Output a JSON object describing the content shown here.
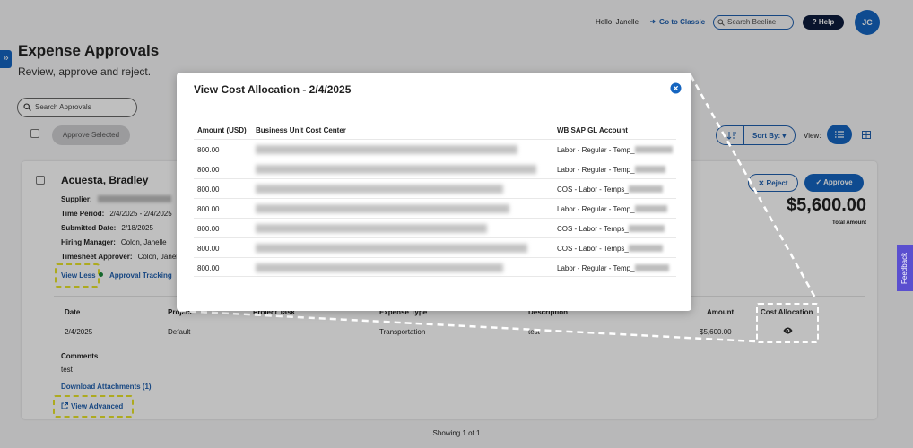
{
  "header": {
    "greeting": "Hello, Janelle",
    "go_classic": "Go to Classic",
    "search_placeholder": "Search Beeline",
    "help_label": "? Help",
    "avatar_initials": "JC"
  },
  "page": {
    "title": "Expense Approvals",
    "subtitle": "Review, approve and reject."
  },
  "toolbar": {
    "search_placeholder": "Search Approvals",
    "approve_selected": "Approve Selected",
    "sort_by": "Sort By:",
    "view_label": "View:"
  },
  "card": {
    "name": "Acuesta, Bradley",
    "supplier_label": "Supplier:",
    "time_period_label": "Time Period:",
    "time_period_value": "2/4/2025 - 2/4/2025",
    "submitted_label": "Submitted Date:",
    "submitted_value": "2/18/2025",
    "hiring_manager_label": "Hiring Manager:",
    "hiring_manager_value": "Colon, Janelle",
    "timesheet_approver_label": "Timesheet Approver:",
    "timesheet_approver_value": "Colon, Janel",
    "view_less": "View Less",
    "approval_tracking": "Approval Tracking",
    "reject": "Reject",
    "approve": "Approve",
    "total": "$5,600.00",
    "total_label": "Total Amount",
    "table_headers": {
      "date": "Date",
      "project": "Project",
      "project_task": "Project Task",
      "expense_type": "Expense Type",
      "description": "Description",
      "amount": "Amount",
      "cost_allocation": "Cost Allocation"
    },
    "row": {
      "date": "2/4/2025",
      "project": "Default",
      "expense_type": "Transportation",
      "description": "test",
      "amount": "$5,600.00"
    },
    "comments_label": "Comments",
    "comments_value": "test",
    "download_attachments": "Download Attachments (1)",
    "view_advanced": "View Advanced"
  },
  "modal": {
    "title": "View Cost Allocation - 2/4/2025",
    "headers": {
      "amount": "Amount (USD)",
      "business_unit": "Business Unit Cost Center",
      "gl_account": "WB SAP GL Account"
    },
    "rows": [
      {
        "amount": "800.00",
        "gl": "Labor - Regular - Temp_"
      },
      {
        "amount": "800.00",
        "gl": "Labor - Regular - Temp_"
      },
      {
        "amount": "800.00",
        "gl": "COS - Labor - Temps_"
      },
      {
        "amount": "800.00",
        "gl": "Labor - Regular - Temp_"
      },
      {
        "amount": "800.00",
        "gl": "COS - Labor - Temps_"
      },
      {
        "amount": "800.00",
        "gl": "COS - Labor - Temps_"
      },
      {
        "amount": "800.00",
        "gl": "Labor - Regular - Temp_"
      }
    ]
  },
  "feedback": "Feedback",
  "footer": {
    "showing": "Showing 1 of 1"
  },
  "colors": {
    "primary": "#1565c0",
    "highlight": "#e7e32a",
    "feedback": "#5a4fcf"
  }
}
